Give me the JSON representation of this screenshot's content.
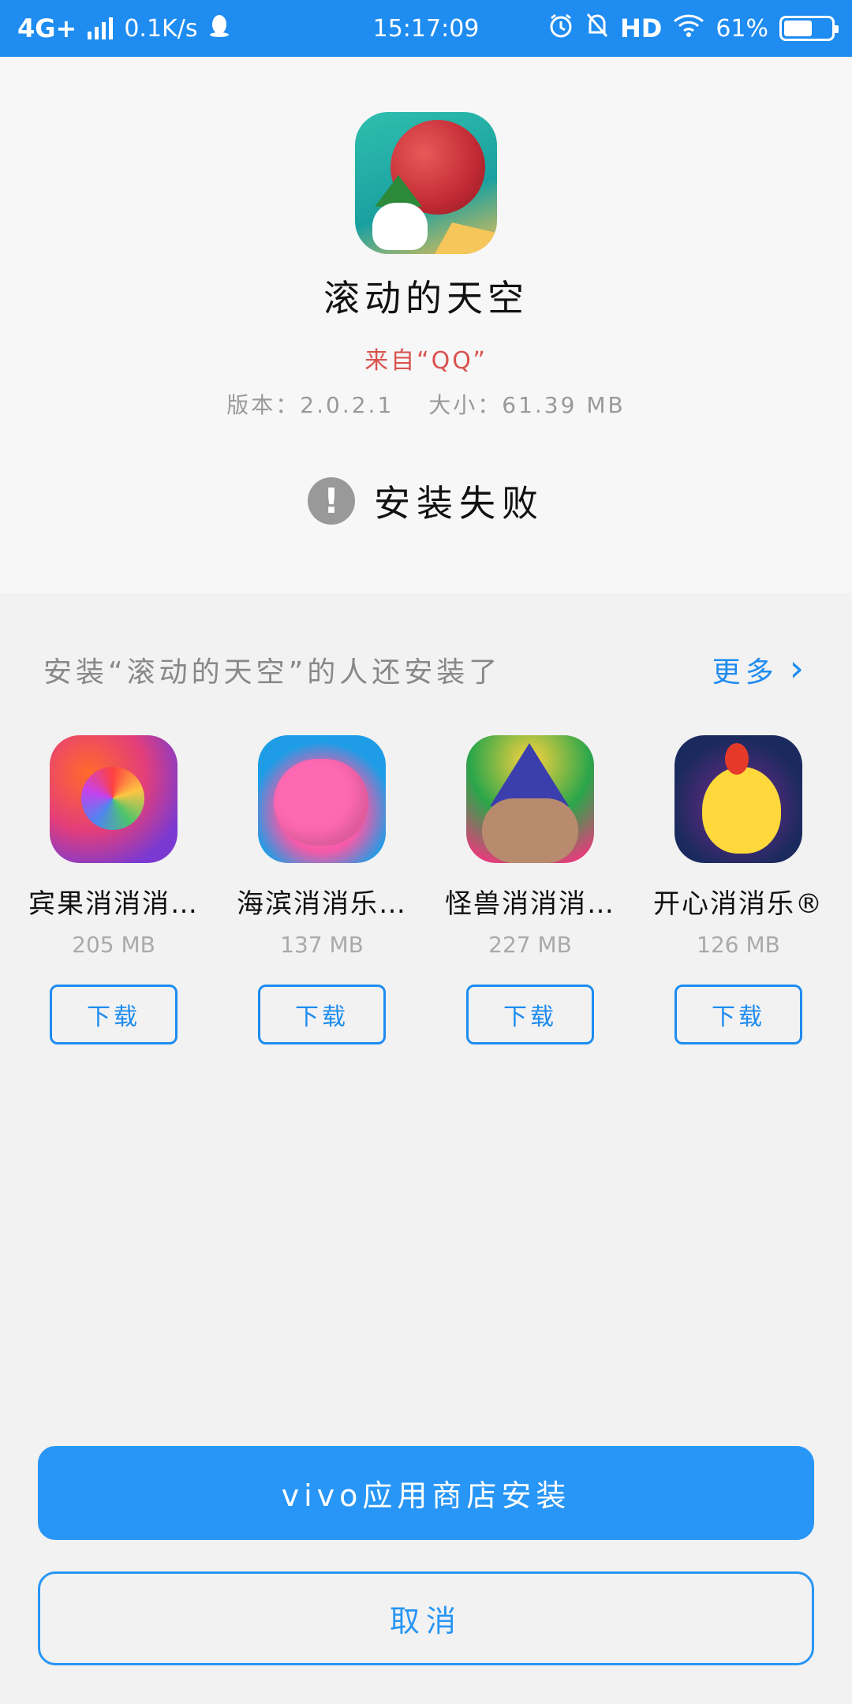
{
  "status_bar": {
    "network": "4G+",
    "speed": "0.1K/s",
    "time": "15:17:09",
    "hd": "HD",
    "battery": "61%",
    "battery_level": 0.61,
    "qq_icon": "qq-penguin-icon",
    "alarm_icon": "alarm-icon",
    "mute_icon": "bell-off-icon",
    "wifi_icon": "wifi-icon"
  },
  "app": {
    "name": "滚动的天空",
    "source": "来自“QQ”",
    "version": "版本：2.0.2.1",
    "size": "大小：61.39 MB",
    "status": "安装失败",
    "status_icon": "!"
  },
  "recommendations": {
    "title": "安装“滚动的天空”的人还安装了",
    "more_label": "更多",
    "more_icon": "›",
    "items": [
      {
        "name": "宾果消消消…",
        "size": "205 MB",
        "button": "下载"
      },
      {
        "name": "海滨消消乐…",
        "size": "137 MB",
        "button": "下载"
      },
      {
        "name": "怪兽消消消…",
        "size": "227 MB",
        "button": "下载"
      },
      {
        "name": "开心消消乐®",
        "size": "126 MB",
        "button": "下载"
      }
    ]
  },
  "actions": {
    "primary": "vivo应用商店安装",
    "secondary": "取消"
  },
  "colors": {
    "status_bar": "#1e8cf0",
    "accent": "#2896f6",
    "source_text": "#d9534f"
  }
}
